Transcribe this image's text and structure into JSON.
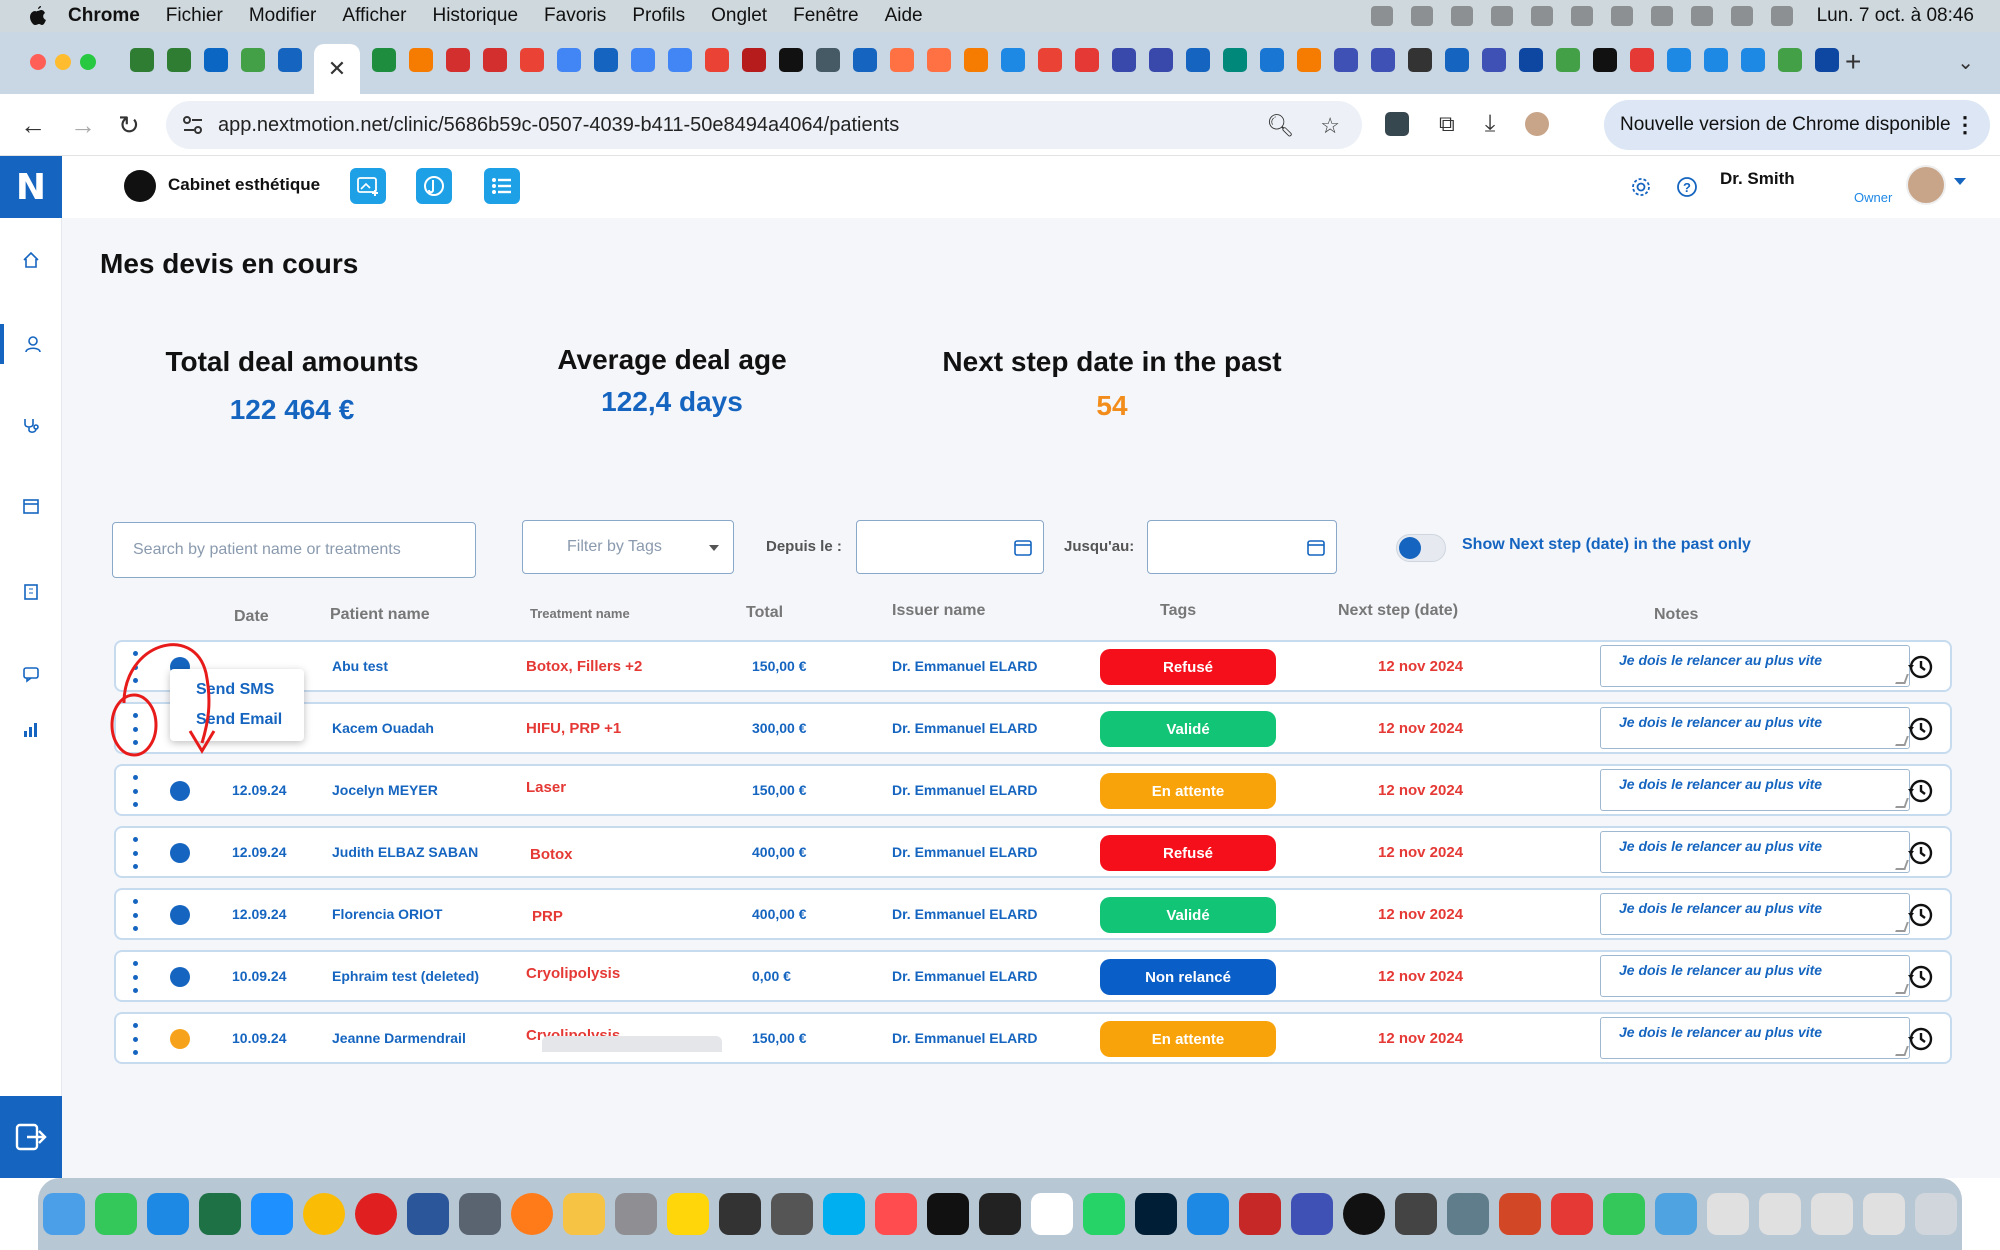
{
  "menubar": {
    "app": "Chrome",
    "items": [
      "Fichier",
      "Modifier",
      "Afficher",
      "Historique",
      "Favoris",
      "Profils",
      "Onglet",
      "Fenêtre",
      "Aide"
    ],
    "clock": "Lun. 7 oct. à 08:46"
  },
  "browser": {
    "url": "app.nextmotion.net/clinic/5686b59c-0507-4039-b411-50e8494a4064/patients",
    "update_label": "Nouvelle version de Chrome disponible"
  },
  "app": {
    "logo_letter": "N",
    "clinic_name": "Cabinet esthétique",
    "user_name": "Dr. Smith",
    "user_role": "Owner"
  },
  "page": {
    "title": "Mes devis en cours"
  },
  "kpis": [
    {
      "label": "Total deal amounts",
      "value": "122 464 €",
      "color": "#1565c0"
    },
    {
      "label": "Average deal age",
      "value": "122,4 days",
      "color": "#1565c0"
    },
    {
      "label": "Next step date in the past",
      "value": "54",
      "color": "#f28c1a"
    }
  ],
  "filters": {
    "search_placeholder": "Search by patient name or treatments",
    "tags_placeholder": "Filter by Tags",
    "since_label": "Depuis le :",
    "until_label": "Jusqu'au:",
    "toggle_label": "Show Next step (date) in the past only"
  },
  "table": {
    "headers": {
      "date": "Date",
      "patient": "Patient name",
      "treatment": "Treatment name",
      "total": "Total",
      "issuer": "Issuer name",
      "tags": "Tags",
      "next": "Next step (date)",
      "notes": "Notes"
    },
    "rows": [
      {
        "date": "",
        "patient": "Abu test",
        "treatment": "Botox, Fillers +2",
        "total": "150,00 €",
        "issuer": "Dr. Emmanuel ELARD",
        "tag": "Refusé",
        "next": "12 nov 2024",
        "note": "Je dois le relancer au plus vite"
      },
      {
        "date": "",
        "patient": "Kacem Ouadah",
        "treatment": "HIFU, PRP +1",
        "total": "300,00 €",
        "issuer": "Dr. Emmanuel ELARD",
        "tag": "Validé",
        "next": "12 nov 2024",
        "note": "Je dois le relancer au plus vite"
      },
      {
        "date": "12.09.24",
        "patient": "Jocelyn MEYER",
        "treatment": "Laser",
        "total": "150,00 €",
        "issuer": "Dr. Emmanuel ELARD",
        "tag": "En attente",
        "next": "12 nov 2024",
        "note": "Je dois le relancer au plus vite"
      },
      {
        "date": "12.09.24",
        "patient": "Judith ELBAZ SABAN",
        "treatment": "Botox",
        "total": "400,00 €",
        "issuer": "Dr. Emmanuel ELARD",
        "tag": "Refusé",
        "next": "12 nov 2024",
        "note": "Je dois le relancer au plus vite"
      },
      {
        "date": "12.09.24",
        "patient": "Florencia ORIOT",
        "treatment": "PRP",
        "total": "400,00 €",
        "issuer": "Dr. Emmanuel ELARD",
        "tag": "Validé",
        "next": "12 nov 2024",
        "note": "Je dois le relancer au plus vite"
      },
      {
        "date": "10.09.24",
        "patient": "Ephraim test (deleted)",
        "treatment": "Cryolipolysis",
        "total": "0,00 €",
        "issuer": "Dr. Emmanuel ELARD",
        "tag": "Non relancé",
        "next": "12 nov 2024",
        "note": "Je dois le relancer au plus vite"
      },
      {
        "date": "10.09.24",
        "patient": "Jeanne Darmendrail",
        "treatment": "Cryolipolysis",
        "total": "150,00 €",
        "issuer": "Dr. Emmanuel ELARD",
        "tag": "En attente",
        "next": "12 nov 2024",
        "note": "Je dois le relancer au plus vite"
      }
    ]
  },
  "row_menu": {
    "send_sms": "Send SMS",
    "send_email": "Send Email"
  },
  "colors": {
    "brand": "#1565c0",
    "refused": "#f40f1b",
    "validated": "#12c475",
    "pending": "#f9a30a",
    "not_followed": "#0a5ec7",
    "dot_blue": "#1565c0",
    "dot_orange": "#f7a21b"
  }
}
